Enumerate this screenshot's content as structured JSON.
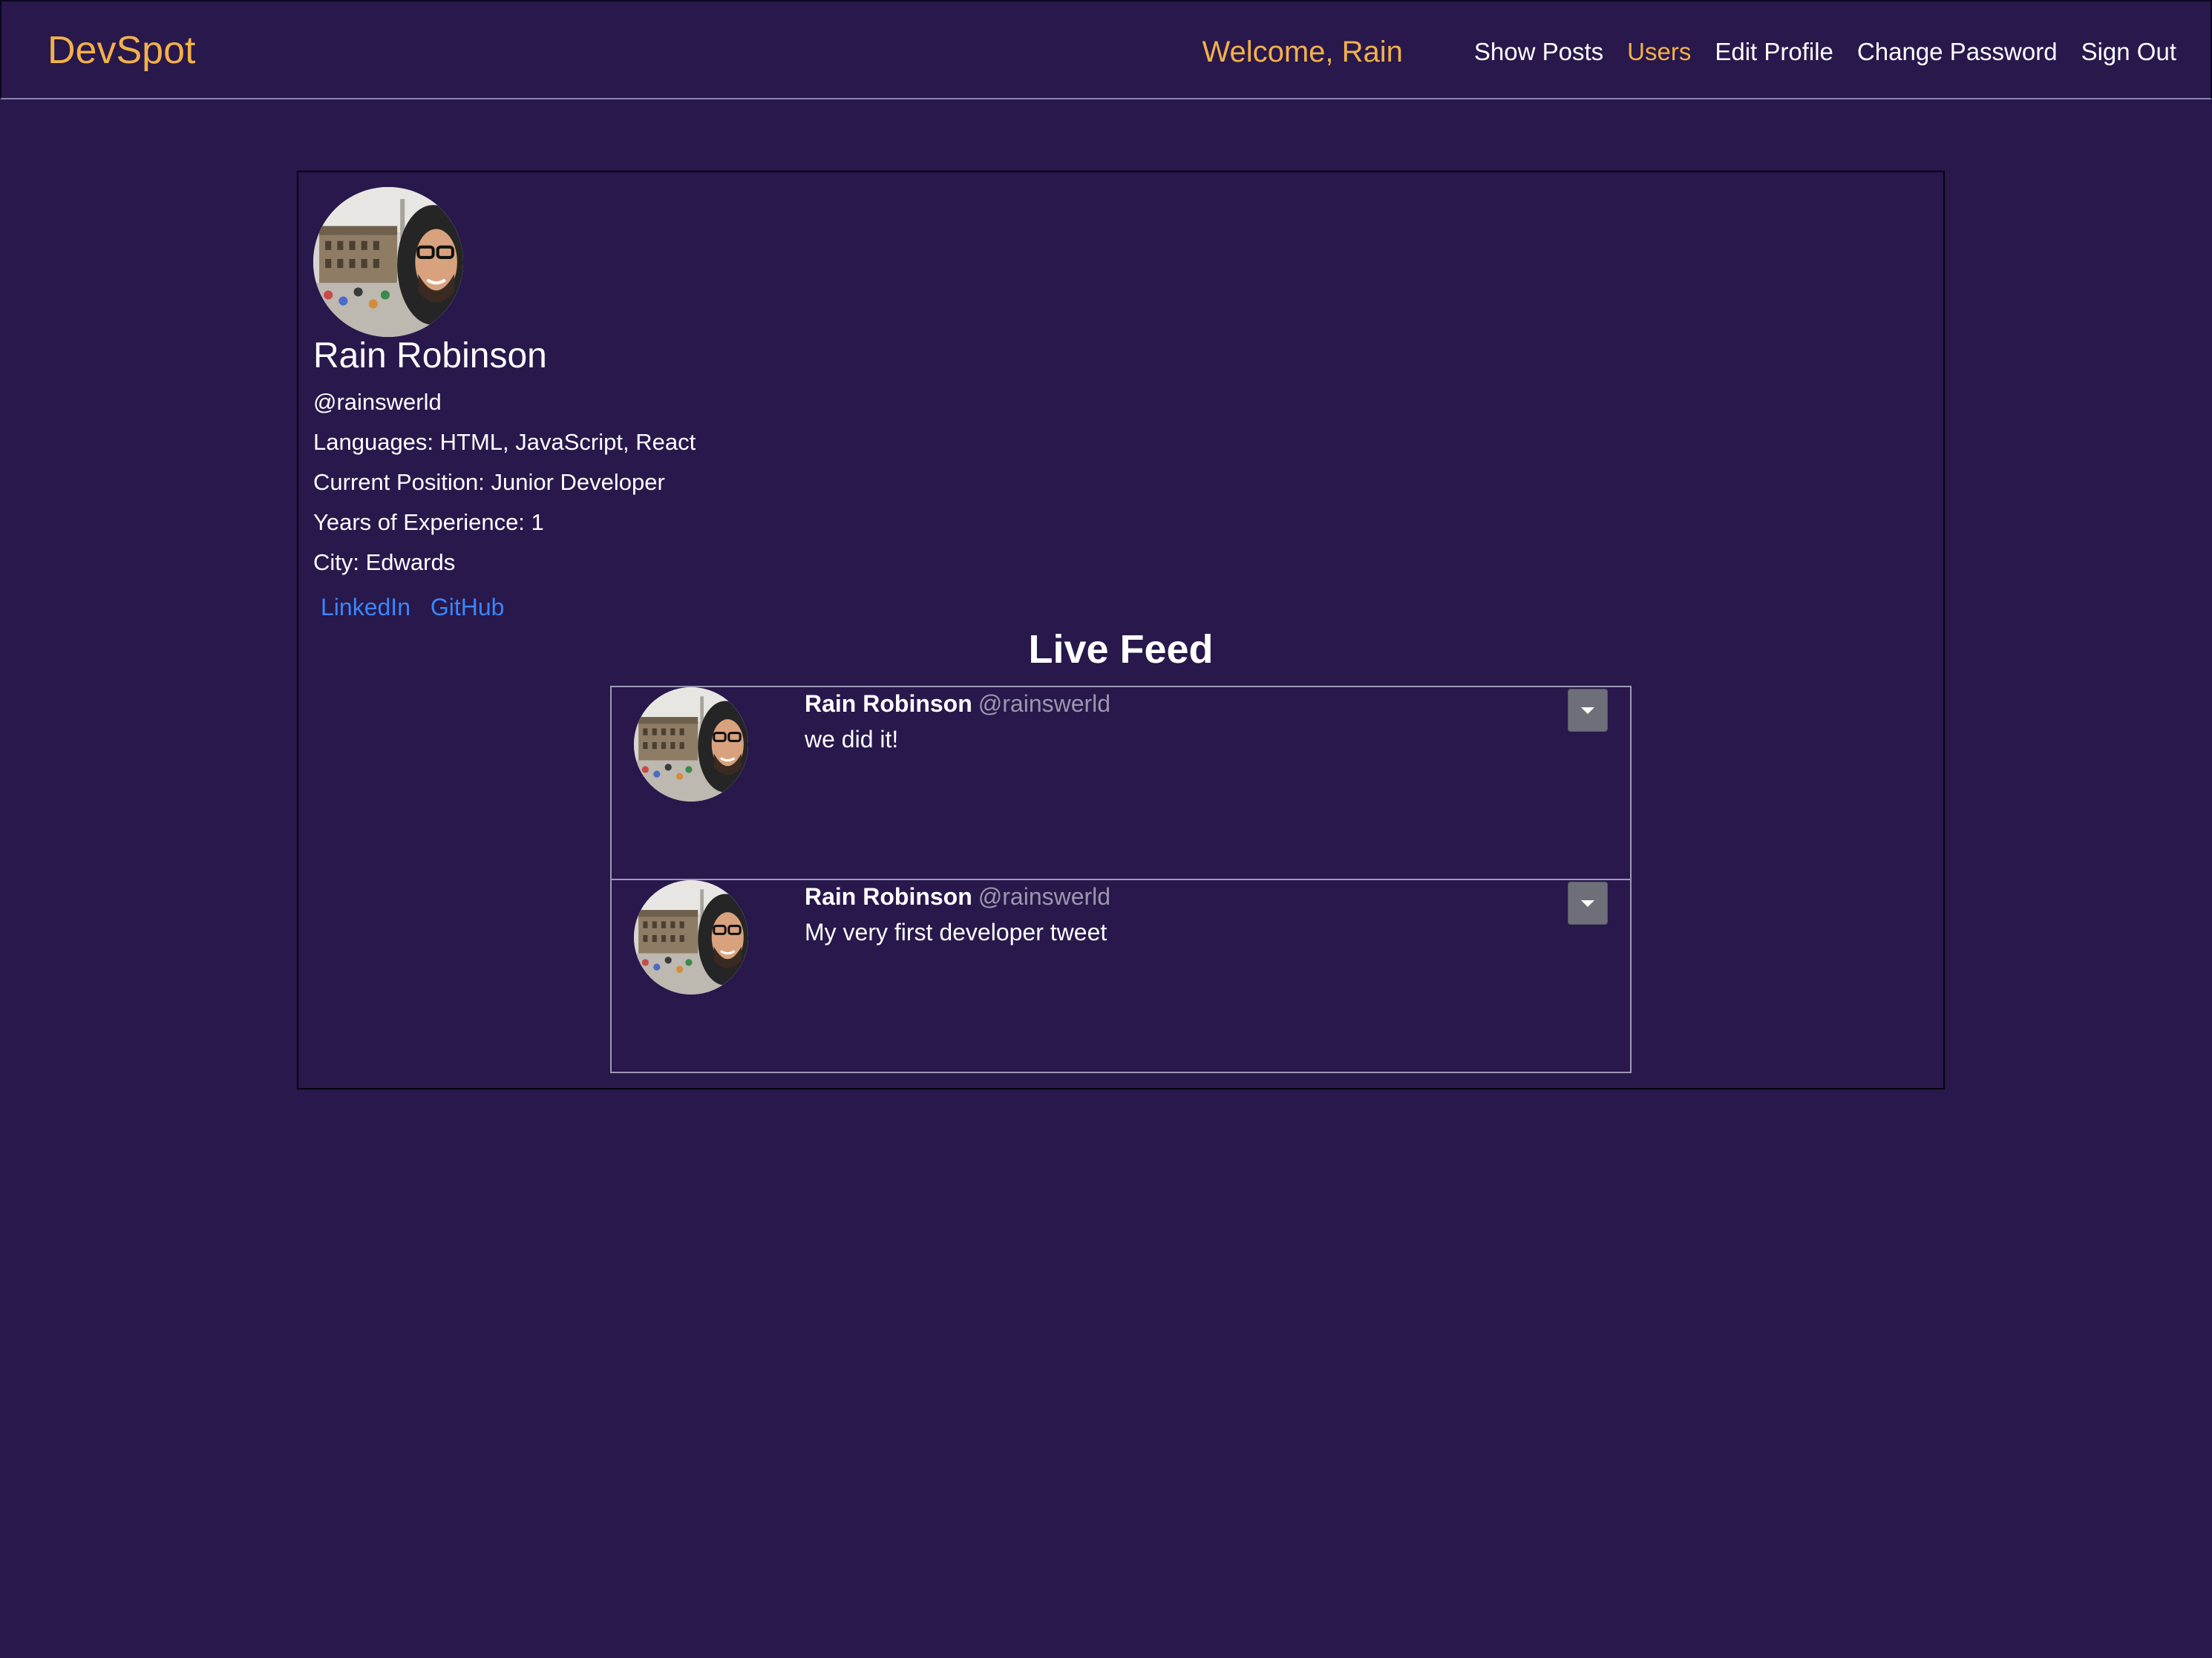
{
  "navbar": {
    "brand": "DevSpot",
    "welcome": "Welcome, Rain",
    "links": [
      {
        "label": "Show Posts",
        "active": false
      },
      {
        "label": "Users",
        "active": true
      },
      {
        "label": "Edit Profile",
        "active": false
      },
      {
        "label": "Change Password",
        "active": false
      },
      {
        "label": "Sign Out",
        "active": false
      }
    ]
  },
  "profile": {
    "avatar_icon": "profile-photo",
    "name": "Rain Robinson",
    "handle": "@rainswerld",
    "languages": "Languages: HTML, JavaScript, React",
    "position": "Current Position: Junior Developer",
    "years": "Years of Experience: 1",
    "city": "City: Edwards",
    "links": [
      "LinkedIn",
      "GitHub"
    ]
  },
  "feed": {
    "title": "Live Feed",
    "posts": [
      {
        "author": "Rain Robinson",
        "handle": "@rainswerld",
        "body": "we did it!"
      },
      {
        "author": "Rain Robinson",
        "handle": "@rainswerld",
        "body": "My very first developer tweet"
      }
    ]
  },
  "colors": {
    "background": "#28184c",
    "accent": "#f3b14a",
    "link": "#3b86f7",
    "muted": "#9c97ad"
  }
}
